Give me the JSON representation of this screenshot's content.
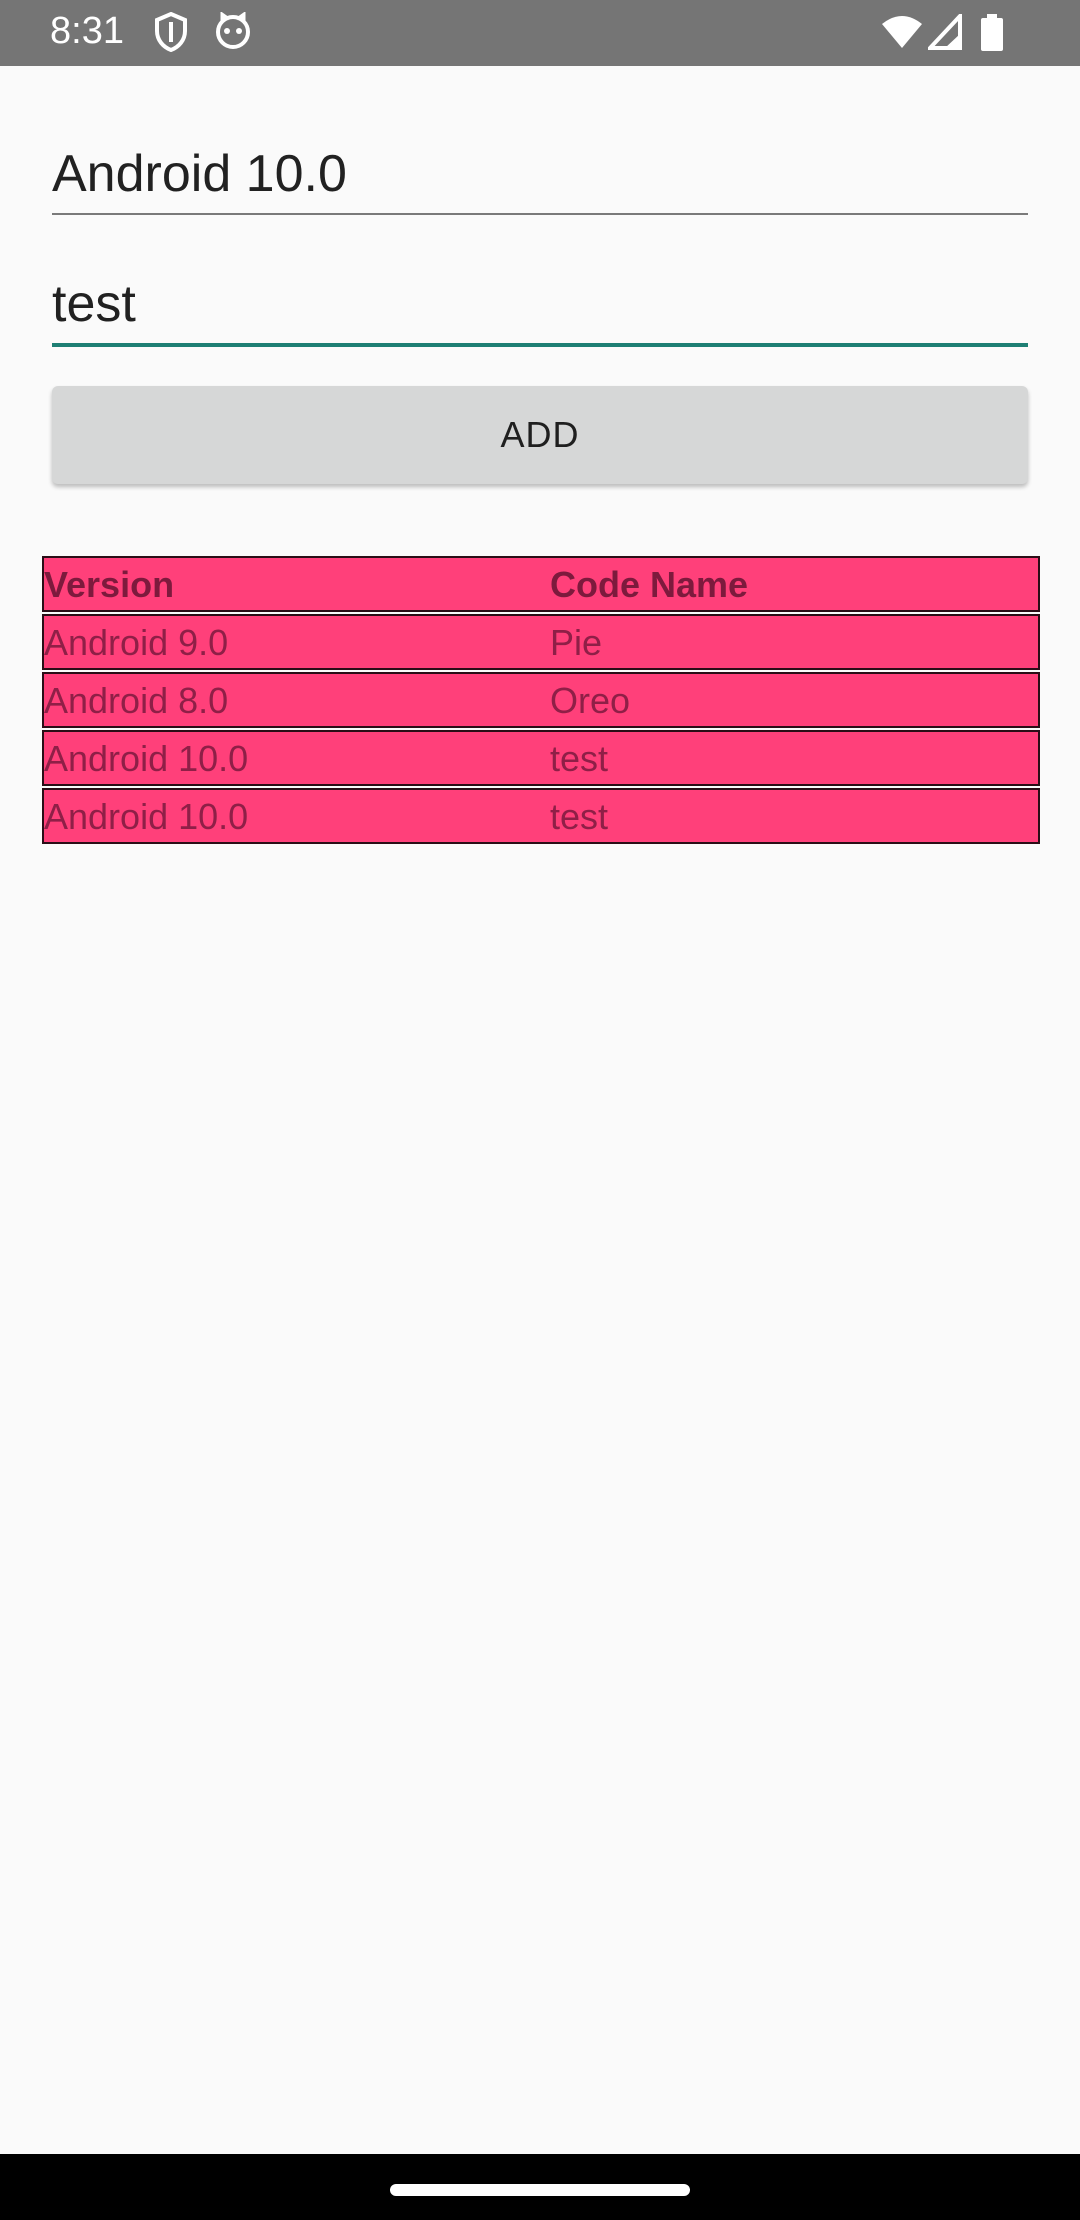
{
  "status_bar": {
    "time": "8:31",
    "icons": [
      "shield-icon",
      "cat-icon",
      "wifi-icon",
      "signal-icon",
      "battery-icon"
    ]
  },
  "form": {
    "version_input": {
      "value": "Android 10.0",
      "placeholder": ""
    },
    "codename_input": {
      "value": "test",
      "placeholder": ""
    },
    "add_label": "ADD"
  },
  "table": {
    "headers": [
      "Version",
      "Code Name"
    ],
    "rows": [
      [
        "Android 9.0",
        "Pie"
      ],
      [
        "Android 8.0",
        "Oreo"
      ],
      [
        "Android 10.0",
        "test"
      ],
      [
        "Android 10.0",
        "test"
      ]
    ]
  },
  "colors": {
    "row_background": "#ff407a",
    "row_text": "#8f1f47",
    "focused_underline": "#1e7f74",
    "button_background": "#d6d7d7"
  }
}
